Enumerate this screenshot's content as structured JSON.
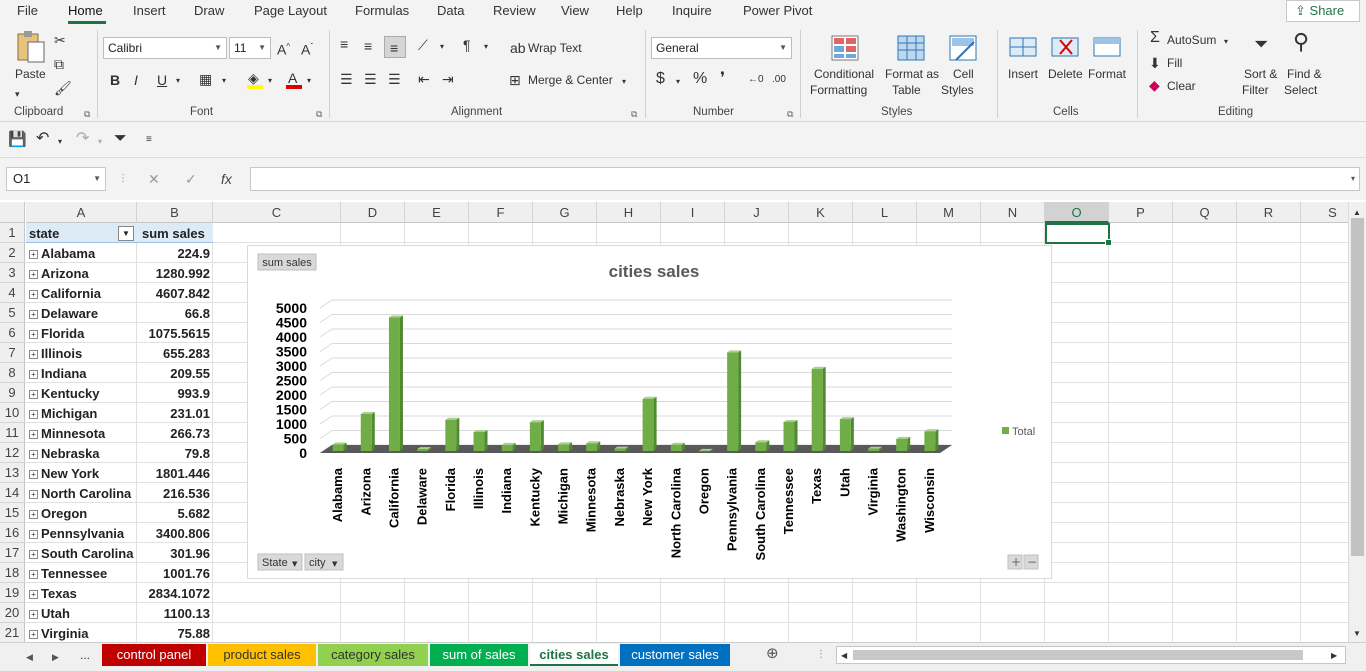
{
  "menu": {
    "items": [
      "File",
      "Home",
      "Insert",
      "Draw",
      "Page Layout",
      "Formulas",
      "Data",
      "Review",
      "View",
      "Help",
      "Inquire",
      "Power Pivot"
    ],
    "active": "Home",
    "share": "Share"
  },
  "ribbon": {
    "clipboard": {
      "paste": "Paste",
      "label": "Clipboard"
    },
    "font": {
      "name": "Calibri",
      "size": "11",
      "label": "Font",
      "bold": "B",
      "italic": "I",
      "underline": "U"
    },
    "alignment": {
      "wrap": "Wrap Text",
      "merge": "Merge & Center",
      "label": "Alignment"
    },
    "number": {
      "format": "General",
      "label": "Number"
    },
    "styles": {
      "conditional": [
        "Conditional",
        "Formatting"
      ],
      "format_table": [
        "Format as",
        "Table"
      ],
      "cell_styles": [
        "Cell",
        "Styles"
      ],
      "label": "Styles"
    },
    "cells": {
      "insert": "Insert",
      "delete": "Delete",
      "format": "Format",
      "label": "Cells"
    },
    "editing": {
      "autosum": "AutoSum",
      "fill": "Fill",
      "clear": "Clear",
      "sort": [
        "Sort &",
        "Filter"
      ],
      "find": [
        "Find &",
        "Select"
      ],
      "label": "Editing"
    }
  },
  "formula_bar": {
    "name_box": "O1",
    "fx": "fx",
    "value": ""
  },
  "columns": [
    "A",
    "B",
    "C",
    "D",
    "E",
    "F",
    "G",
    "H",
    "I",
    "J",
    "K",
    "L",
    "M",
    "N",
    "O",
    "P",
    "Q",
    "R",
    "S"
  ],
  "selected_column": "O",
  "rows": [
    "1",
    "2",
    "3",
    "4",
    "5",
    "6",
    "7",
    "8",
    "9",
    "10",
    "11",
    "12",
    "13",
    "14",
    "15",
    "16",
    "17",
    "18",
    "19",
    "20",
    "21"
  ],
  "pivot": {
    "header_state": "state",
    "header_sales": "sum sales",
    "records": [
      {
        "state": "Alabama",
        "sales": "224.9"
      },
      {
        "state": "Arizona",
        "sales": "1280.992"
      },
      {
        "state": "California",
        "sales": "4607.842"
      },
      {
        "state": "Delaware",
        "sales": "66.8"
      },
      {
        "state": "Florida",
        "sales": "1075.5615"
      },
      {
        "state": "Illinois",
        "sales": "655.283"
      },
      {
        "state": "Indiana",
        "sales": "209.55"
      },
      {
        "state": "Kentucky",
        "sales": "993.9"
      },
      {
        "state": "Michigan",
        "sales": "231.01"
      },
      {
        "state": "Minnesota",
        "sales": "266.73"
      },
      {
        "state": "Nebraska",
        "sales": "79.8"
      },
      {
        "state": "New York",
        "sales": "1801.446"
      },
      {
        "state": "North Carolina",
        "sales": "216.536"
      },
      {
        "state": "Oregon",
        "sales": "5.682"
      },
      {
        "state": "Pennsylvania",
        "sales": "3400.806"
      },
      {
        "state": "South Carolina",
        "sales": "301.96"
      },
      {
        "state": "Tennessee",
        "sales": "1001.76"
      },
      {
        "state": "Texas",
        "sales": "2834.1072"
      },
      {
        "state": "Utah",
        "sales": "1100.13"
      },
      {
        "state": "Virginia",
        "sales": "75.88"
      }
    ]
  },
  "chart_data": {
    "type": "bar",
    "title": "cities sales",
    "field_button": "sum sales",
    "axis_buttons": [
      "State",
      "city"
    ],
    "categories": [
      "Alabama",
      "Arizona",
      "California",
      "Delaware",
      "Florida",
      "Illinois",
      "Indiana",
      "Kentucky",
      "Michigan",
      "Minnesota",
      "Nebraska",
      "New York",
      "North Carolina",
      "Oregon",
      "Pennsylvania",
      "South Carolina",
      "Tennessee",
      "Texas",
      "Utah",
      "Virginia",
      "Washington",
      "Wisconsin"
    ],
    "series": [
      {
        "name": "Total",
        "values": [
          224.9,
          1280.992,
          4607.842,
          66.8,
          1075.5615,
          655.283,
          209.55,
          993.9,
          231.01,
          266.73,
          79.8,
          1801.446,
          216.536,
          5.682,
          3400.806,
          301.96,
          1001.76,
          2834.1072,
          1100.13,
          75.88,
          420,
          680
        ]
      }
    ],
    "yticks": [
      "0",
      "500",
      "1000",
      "1500",
      "2000",
      "2500",
      "3000",
      "3500",
      "4000",
      "4500",
      "5000"
    ],
    "ylim": [
      0,
      5000
    ],
    "legend": "right",
    "color": "#70ad47"
  },
  "sheets": {
    "nav_more": "...",
    "tabs": [
      {
        "name": "control panel",
        "bg": "#c00000",
        "fg": "#ffffff"
      },
      {
        "name": "product sales",
        "bg": "#ffc000",
        "fg": "#333333"
      },
      {
        "name": "category sales",
        "bg": "#92d050",
        "fg": "#333333"
      },
      {
        "name": "sum of sales",
        "bg": "#00b050",
        "fg": "#ffffff"
      },
      {
        "name": "cities sales",
        "bg": "#ffffff",
        "fg": "#217346"
      },
      {
        "name": "customer sales",
        "bg": "#0070c0",
        "fg": "#ffffff"
      }
    ],
    "active": "cities sales"
  }
}
